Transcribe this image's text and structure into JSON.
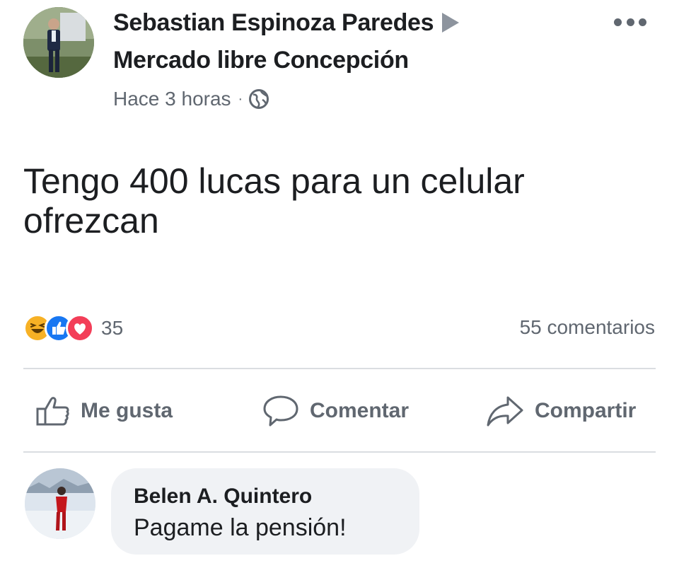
{
  "post": {
    "author_name": "Sebastian Espinoza Paredes",
    "group_name": "Mercado libre Concepción",
    "timestamp": "Hace 3 horas",
    "separator": "·",
    "privacy_icon": "globe-icon",
    "more_icon": "more-options-icon",
    "text_line1": "Tengo 400 lucas para un celular",
    "text_line2": "ofrezcan"
  },
  "stats": {
    "reactions": [
      "haha-icon",
      "like-reaction-icon",
      "love-reaction-icon"
    ],
    "reaction_count": "35",
    "comments_count": "55 comentarios"
  },
  "actions": {
    "like_label": "Me gusta",
    "comment_label": "Comentar",
    "share_label": "Compartir"
  },
  "comment": {
    "author_name": "Belen A. Quintero",
    "text": "Pagame la pensión!"
  },
  "colors": {
    "text": "#1c1e21",
    "secondary": "#606770",
    "like_blue": "#1877f2",
    "love_red": "#f33e58",
    "haha_yellow": "#f7b125",
    "bubble": "#f0f2f5"
  }
}
